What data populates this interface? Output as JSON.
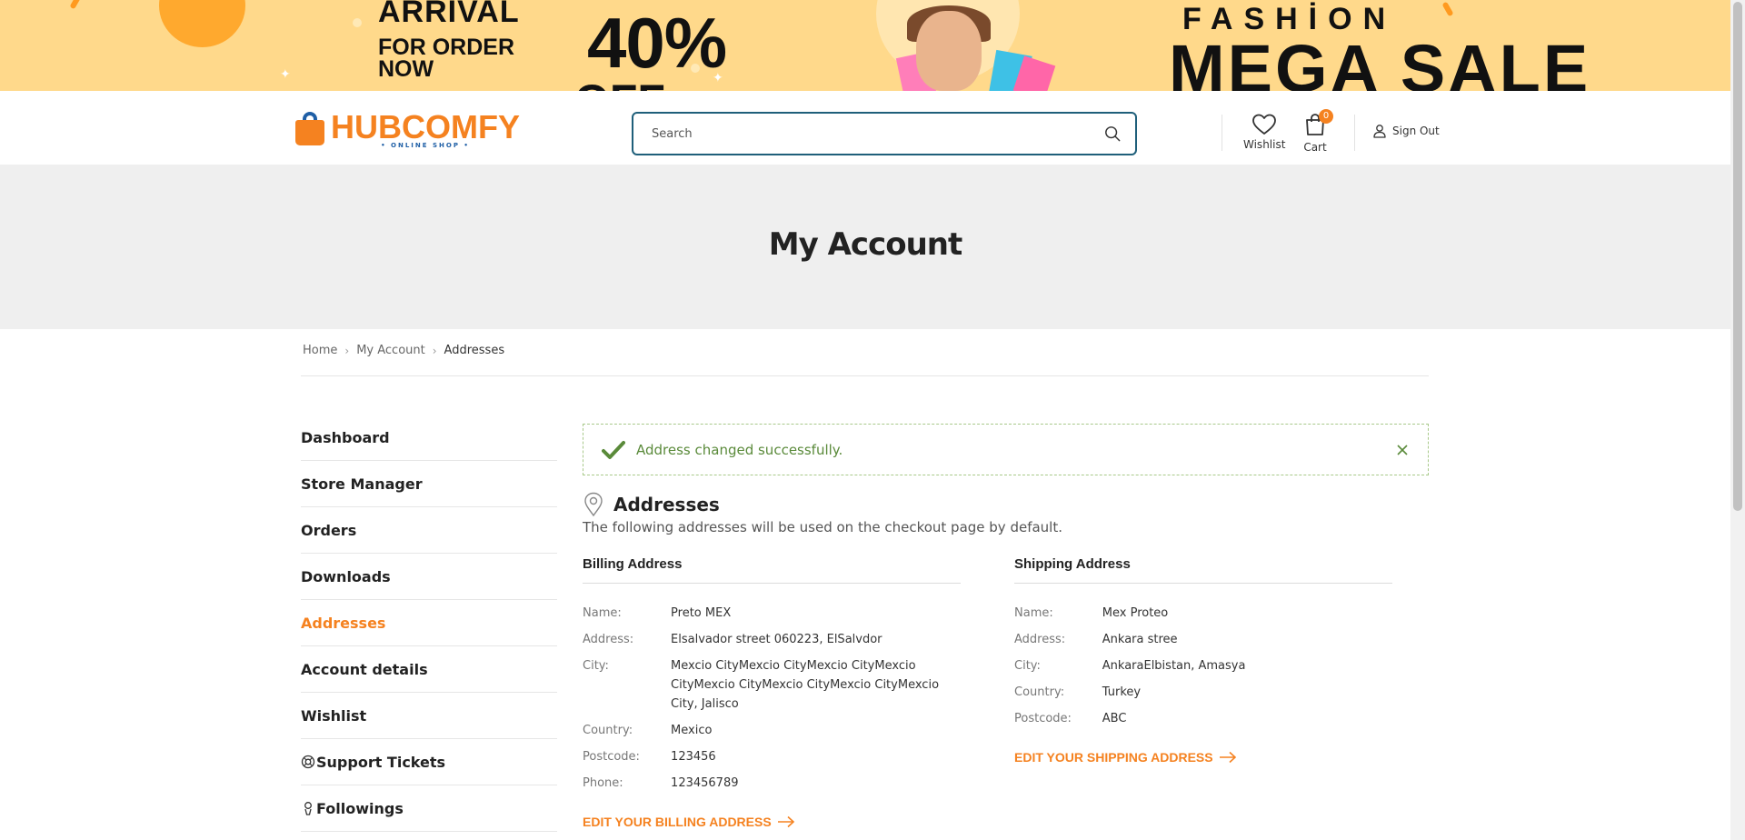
{
  "banner": {
    "arrival": "ARRİVAL",
    "for_order": "FOR ORDER NOW",
    "percent": "40%",
    "off": "OFF",
    "fashion": "FASHİON",
    "mega_sale": "MEGA SALE"
  },
  "header": {
    "logo_name": "HUBCOMFY",
    "logo_sub": "• ONLINE SHOP •",
    "search_placeholder": "Search",
    "wishlist_label": "Wishlist",
    "cart_label": "Cart",
    "cart_count": "0",
    "signout_label": "Sign Out"
  },
  "page": {
    "title": "My Account"
  },
  "breadcrumb": [
    "Home",
    "My Account",
    "Addresses"
  ],
  "sidebar": {
    "items": [
      {
        "label": "Dashboard"
      },
      {
        "label": "Store Manager"
      },
      {
        "label": "Orders"
      },
      {
        "label": "Downloads"
      },
      {
        "label": "Addresses"
      },
      {
        "label": "Account details"
      },
      {
        "label": "Wishlist"
      },
      {
        "label": "Support Tickets"
      },
      {
        "label": "Followings"
      }
    ]
  },
  "notice": {
    "message": "Address changed successfully."
  },
  "addresses": {
    "heading": "Addresses",
    "description": "The following addresses will be used on the checkout page by default.",
    "billing": {
      "title": "Billing Address",
      "rows": [
        {
          "k": "Name:",
          "v": "Preto MEX"
        },
        {
          "k": "Address:",
          "v": "Elsalvador street 060223, ElSalvdor"
        },
        {
          "k": "City:",
          "v": "Mexcio CityMexcio CityMexcio CityMexcio CityMexcio CityMexcio CityMexcio CityMexcio City, Jalisco"
        },
        {
          "k": "Country:",
          "v": "Mexico"
        },
        {
          "k": "Postcode:",
          "v": "123456"
        },
        {
          "k": "Phone:",
          "v": "123456789"
        }
      ],
      "edit_label": "EDIT YOUR BILLING ADDRESS"
    },
    "shipping": {
      "title": "Shipping Address",
      "rows": [
        {
          "k": "Name:",
          "v": "Mex Proteo"
        },
        {
          "k": "Address:",
          "v": "Ankara stree"
        },
        {
          "k": "City:",
          "v": "AnkaraElbistan, Amasya"
        },
        {
          "k": "Country:",
          "v": "Turkey"
        },
        {
          "k": "Postcode:",
          "v": "ABC"
        }
      ],
      "edit_label": "EDIT YOUR SHIPPING ADDRESS"
    }
  },
  "colors": {
    "accent": "#f58220",
    "brand_blue": "#1f5fa6",
    "banner_bg": "#ffd98b",
    "title_bg": "#efefef",
    "success": "#5a8a3a"
  },
  "icons": [
    "search-icon",
    "heart-icon",
    "cart-icon",
    "user-icon",
    "check-icon",
    "close-icon",
    "location-pin-icon",
    "arrow-right-icon",
    "support-icon",
    "followings-icon"
  ]
}
